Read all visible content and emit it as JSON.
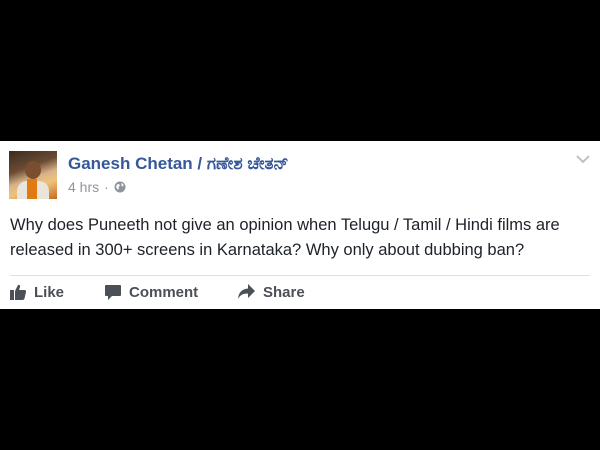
{
  "post": {
    "author": "Ganesh Chetan / ಗಣೇಶ ಚೇತನ್",
    "time": "4 hrs",
    "separator": "·",
    "text": "Why does Puneeth not give an opinion when Telugu / Tamil / Hindi films are released in 300+ screens in Karnataka? Why only about dubbing ban?"
  },
  "actions": {
    "like_label": "Like",
    "comment_label": "Comment",
    "share_label": "Share"
  },
  "icons": {
    "audience": "globe-icon",
    "menu": "chevron-down-icon",
    "like": "thumbs-up-icon",
    "comment": "speech-bubble-icon",
    "share": "share-arrow-icon"
  },
  "colors": {
    "author_link": "#365899",
    "meta": "#90949c",
    "text": "#1d2129",
    "action": "#4b4f56",
    "background": "#000000"
  }
}
